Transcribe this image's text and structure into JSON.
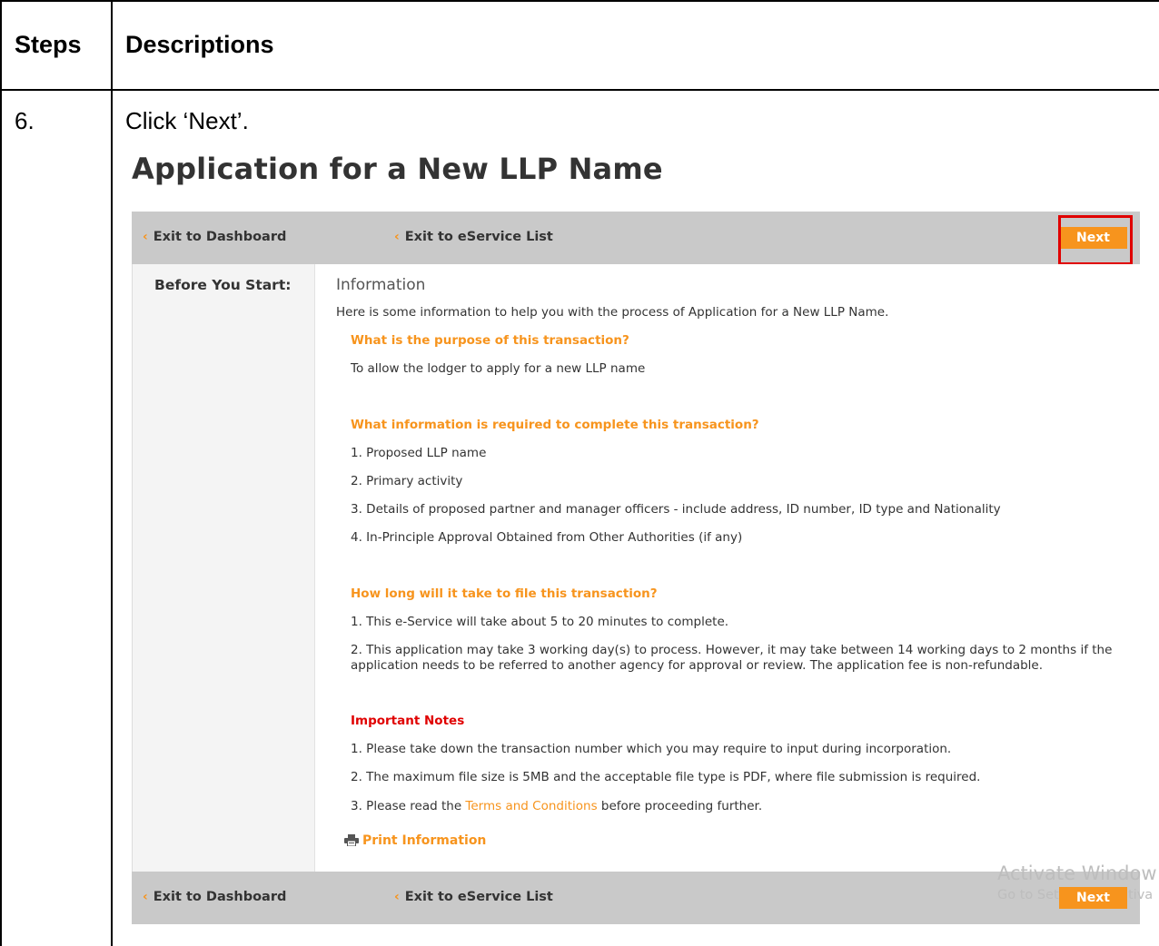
{
  "table": {
    "header_steps": "Steps",
    "header_descriptions": "Descriptions",
    "step_number": "6.",
    "step_description": "Click ‘Next’."
  },
  "app": {
    "title": "Application for a New LLP Name",
    "nav": {
      "exit_dashboard": "Exit to Dashboard",
      "exit_eservice": "Exit to eService List",
      "next": "Next"
    },
    "sidebar_label": "Before You Start:",
    "info_heading": "Information",
    "intro": "Here is some information to help you with the process of Application for a New LLP Name.",
    "q1": "What is the purpose of this transaction?",
    "a1": "To allow the lodger to apply for a new LLP name",
    "q2": "What information is required to complete this transaction?",
    "q2_items": [
      "1. Proposed LLP name",
      "2. Primary activity",
      "3. Details of proposed partner and manager officers - include address, ID number, ID type and Nationality",
      "4. In-Principle Approval Obtained from Other Authorities (if any)"
    ],
    "q3": "How long will it take to file this transaction?",
    "q3_items": [
      "1. This e-Service will take about 5 to 20 minutes to complete.",
      "2. This application may take 3 working day(s) to process. However, it may take between 14 working days to 2 months if the",
      "application needs to be referred to another agency for approval or review. The application fee is non-refundable."
    ],
    "notes_heading": "Important Notes",
    "notes": [
      "1. Please take down the transaction number which you may require to input during incorporation.",
      "2. The maximum file size is 5MB and the acceptable file type is PDF, where file submission is required."
    ],
    "note3_prefix": "3. Please read the ",
    "note3_link": "Terms and Conditions",
    "note3_suffix": " before proceeding further.",
    "print": "Print Information"
  },
  "watermark": {
    "line1": "Activate Window",
    "line2_left": "Go to Set",
    "line2_right": "tiva"
  },
  "colors": {
    "accent": "#f7941d",
    "highlight": "#e00000",
    "bar": "#c9c9c9"
  },
  "icons": {
    "chevron": "chevron-left-icon",
    "print": "printer-icon"
  }
}
